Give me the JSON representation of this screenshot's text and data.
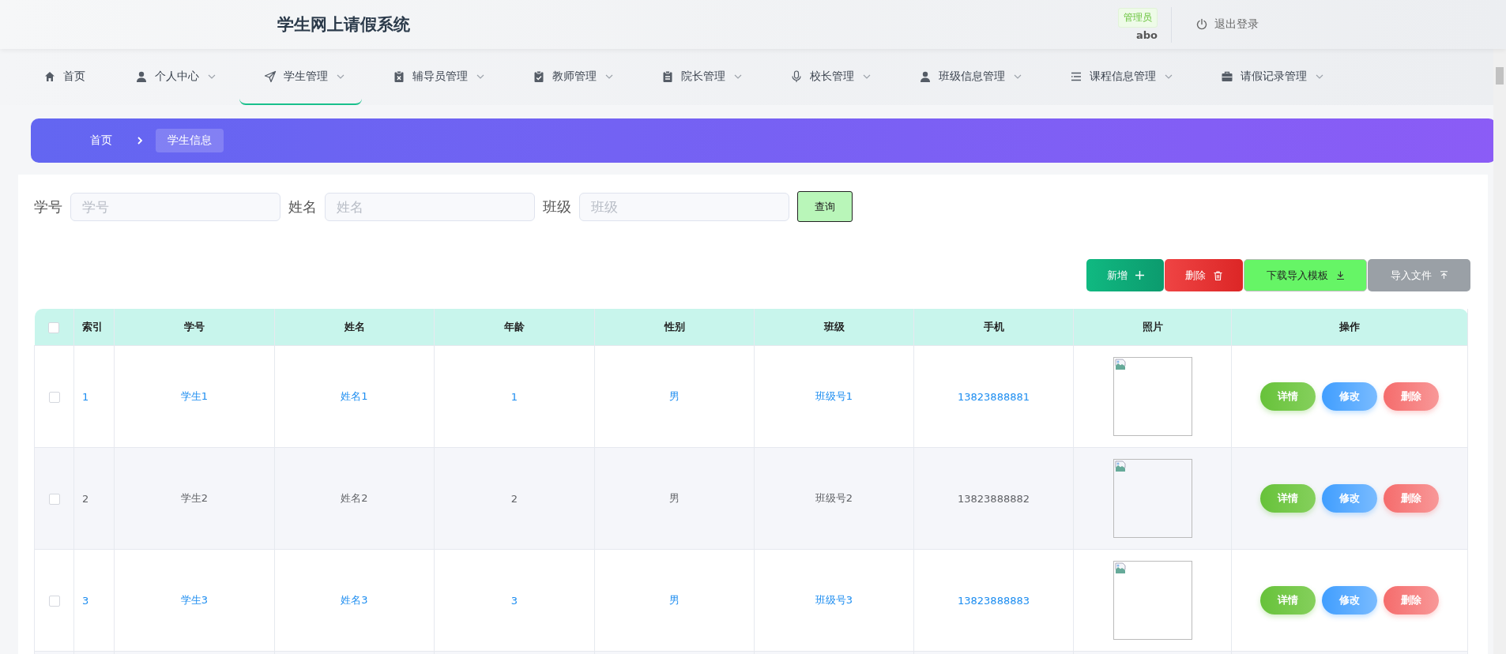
{
  "header": {
    "title": "学生网上请假系统",
    "role_badge": "管理员",
    "username": "abo",
    "logout": "退出登录"
  },
  "nav": [
    {
      "label": "首页",
      "dropdown": false,
      "selected": false
    },
    {
      "label": "个人中心",
      "dropdown": true,
      "selected": false
    },
    {
      "label": "学生管理",
      "dropdown": true,
      "selected": true
    },
    {
      "label": "辅导员管理",
      "dropdown": true,
      "selected": false
    },
    {
      "label": "教师管理",
      "dropdown": true,
      "selected": false
    },
    {
      "label": "院长管理",
      "dropdown": true,
      "selected": false
    },
    {
      "label": "校长管理",
      "dropdown": true,
      "selected": false
    },
    {
      "label": "班级信息管理",
      "dropdown": true,
      "selected": false
    },
    {
      "label": "课程信息管理",
      "dropdown": true,
      "selected": false
    },
    {
      "label": "请假记录管理",
      "dropdown": true,
      "selected": false
    }
  ],
  "breadcrumb": [
    {
      "label": "首页",
      "selected": false
    },
    {
      "label": "学生信息",
      "selected": true
    }
  ],
  "search": {
    "fields": [
      {
        "label": "学号",
        "placeholder": "学号"
      },
      {
        "label": "姓名",
        "placeholder": "姓名"
      },
      {
        "label": "班级",
        "placeholder": "班级"
      }
    ],
    "button": "查询"
  },
  "actions": [
    {
      "label": "新增",
      "kind": "add"
    },
    {
      "label": "删除",
      "kind": "delete"
    },
    {
      "label": "下载导入模板",
      "kind": "download"
    },
    {
      "label": "导入文件",
      "kind": "import"
    }
  ],
  "table": {
    "select_all_checked": false,
    "columns": [
      "索引",
      "学号",
      "姓名",
      "年龄",
      "性别",
      "班级",
      "手机",
      "照片",
      "操作"
    ],
    "rows": [
      {
        "checked": false,
        "highlighted": true,
        "cells": [
          "1",
          "学生1",
          "姓名1",
          "1",
          "男",
          "班级号1",
          "13823888881"
        ],
        "buttons": [
          "详情",
          "修改",
          "删除"
        ]
      },
      {
        "checked": false,
        "highlighted": false,
        "cells": [
          "2",
          "学生2",
          "姓名2",
          "2",
          "男",
          "班级号2",
          "13823888882"
        ],
        "buttons": [
          "详情",
          "修改",
          "删除"
        ]
      },
      {
        "checked": false,
        "highlighted": true,
        "cells": [
          "3",
          "学生3",
          "姓名3",
          "3",
          "男",
          "班级号3",
          "13823888883"
        ],
        "buttons": [
          "详情",
          "修改",
          "删除"
        ]
      }
    ]
  }
}
